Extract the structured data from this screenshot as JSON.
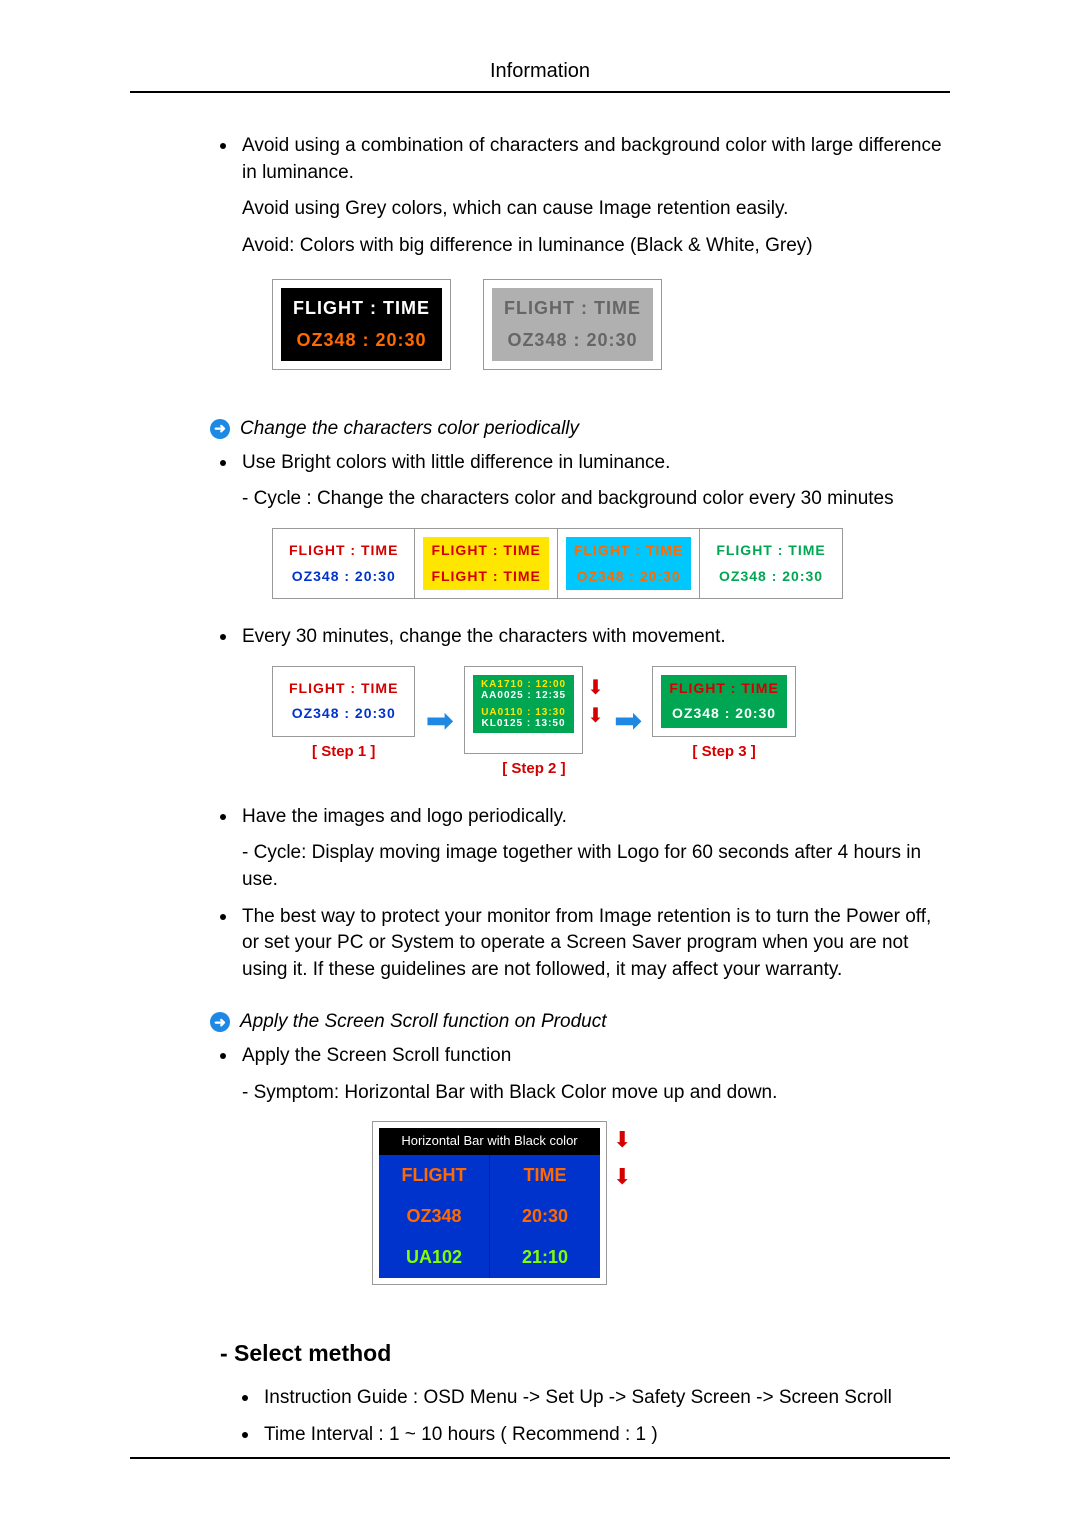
{
  "header": {
    "title": "Information"
  },
  "para": {
    "avoid_combo": "Avoid using a combination of characters and background color with large difference in luminance.",
    "avoid_grey": "Avoid using Grey colors, which can cause Image retention easily.",
    "avoid_colors": "Avoid: Colors with big difference in luminance (Black & White, Grey)",
    "use_bright": "Use Bright colors with little difference in luminance.",
    "cycle30": "- Cycle : Change the characters color and background color every 30 minutes",
    "every30": "Every 30 minutes, change the characters with movement.",
    "have_images": "Have the images and logo periodically.",
    "cycle_logo": "- Cycle: Display moving image together with Logo for 60 seconds after 4 hours in use.",
    "best_way": "The best way to protect your monitor from Image retention is to turn the Power off, or set your PC or System to operate a Screen Saver program when you are not using it. If these guidelines are not followed, it may affect your warranty.",
    "apply_scroll": "Apply the Screen Scroll function",
    "symptom": "- Symptom: Horizontal Bar with Black Color move up and down.",
    "instruction_guide": "Instruction Guide : OSD Menu -> Set Up -> Safety Screen -> Screen Scroll",
    "time_interval": "Time Interval : 1 ~ 10 hours ( Recommend : 1 )"
  },
  "notes": {
    "change_color": "Change the characters color periodically",
    "apply_scroll_product": "Apply the Screen Scroll function on Product"
  },
  "fig_luminance": {
    "a": {
      "line1": "FLIGHT  :  TIME",
      "line2": "OZ348    :  20:30"
    },
    "b": {
      "line1": "FLIGHT  :  TIME",
      "line2": "OZ348    :  20:30"
    }
  },
  "fig_cycle": {
    "c1": {
      "l1": "FLIGHT  :  TIME",
      "l2": "OZ348    :  20:30"
    },
    "c2": {
      "l1": "FLIGHT  :  TIME",
      "l2": "FLIGHT  :  TIME"
    },
    "c3": {
      "l1": "FLIGHT  :  TIME",
      "l2": "OZ348    :  20:30"
    },
    "c4": {
      "l1": "FLIGHT  :  TIME",
      "l2": "OZ348    :  20:30"
    }
  },
  "fig_movement": {
    "step1": {
      "l1": "FLIGHT  :  TIME",
      "l2": "OZ348   :  20:30",
      "label": "[  Step 1  ]"
    },
    "step2": {
      "l1": "KA1710  :  12:00",
      "l1b": "AA0025  :  12:35",
      "l2": "UA0110   :  13:30",
      "l2b": "KL0125   :  13:50",
      "label": "[  Step 2  ]"
    },
    "step3": {
      "l1": "FLIGHT  :  TIME",
      "l2": "OZ348   :  20:30",
      "label": "[  Step 3  ]"
    }
  },
  "scroll": {
    "bar": "Horizontal Bar with Black color",
    "h1": "FLIGHT",
    "h2": "TIME",
    "r1c1": "OZ348",
    "r1c2": "20:30",
    "r2c1": "UA102",
    "r2c2": "21:10"
  },
  "section": {
    "select_method": "- Select method"
  }
}
